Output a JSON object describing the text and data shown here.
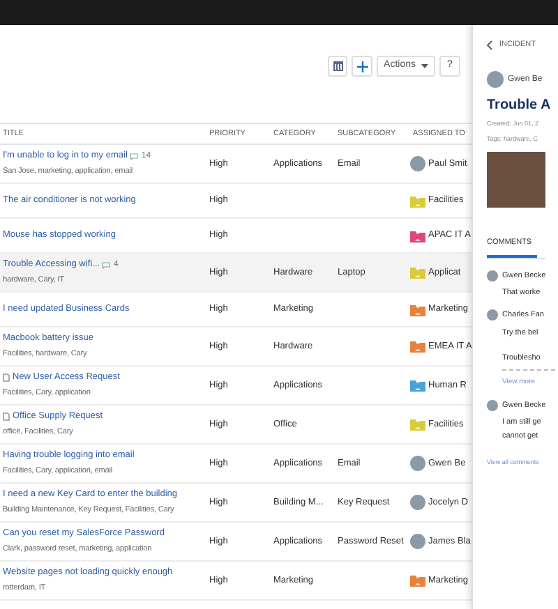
{
  "toolbar": {
    "actions_label": "Actions",
    "help_label": "?"
  },
  "table": {
    "columns": [
      "TITLE",
      "PRIORITY",
      "CATEGORY",
      "SUBCATEGORY",
      "ASSIGNED TO"
    ],
    "rows": [
      {
        "title": "I'm unable to log in to my email",
        "comment_count": "14",
        "tags": "San Jose, marketing, application, email",
        "attachment": false,
        "selected": false,
        "priority": "High",
        "category": "Applications",
        "subcategory": "Email",
        "assigned": {
          "name": "Paul Smit",
          "kind": "person"
        }
      },
      {
        "title": "The air conditioner is not working",
        "attachment": false,
        "selected": false,
        "priority": "High",
        "category": "",
        "subcategory": "",
        "assigned": {
          "name": "Facilities",
          "kind": "group",
          "color": "#d8cc3a"
        }
      },
      {
        "title": "Mouse has stopped working",
        "attachment": false,
        "selected": false,
        "priority": "High",
        "category": "",
        "subcategory": "",
        "assigned": {
          "name": "APAC IT A",
          "kind": "group",
          "color": "#e0457b"
        }
      },
      {
        "title": "Trouble Accessing wifi...",
        "comment_count": "4",
        "tags": "hardware, Cary, IT",
        "attachment": false,
        "selected": true,
        "priority": "High",
        "category": "Hardware",
        "subcategory": "Laptop",
        "assigned": {
          "name": "Applicat",
          "kind": "group",
          "color": "#d8cc3a"
        }
      },
      {
        "title": "I need updated Business Cards",
        "attachment": false,
        "selected": false,
        "priority": "High",
        "category": "Marketing",
        "subcategory": "",
        "assigned": {
          "name": "Marketing",
          "kind": "group",
          "color": "#e8813a"
        }
      },
      {
        "title": "Macbook battery issue",
        "tags": "Facilities, hardware, Cary",
        "attachment": false,
        "selected": false,
        "priority": "High",
        "category": "Hardware",
        "subcategory": "",
        "assigned": {
          "name": "EMEA IT A",
          "kind": "group",
          "color": "#e8813a"
        }
      },
      {
        "title": "New User Access Request",
        "tags": "Facilities, Cary, application",
        "attachment": true,
        "selected": false,
        "priority": "High",
        "category": "Applications",
        "subcategory": "",
        "assigned": {
          "name": "Human R",
          "kind": "group",
          "color": "#4aa3d8"
        }
      },
      {
        "title": "Office Supply Request",
        "tags": "office, Facilities, Cary",
        "attachment": true,
        "selected": false,
        "priority": "High",
        "category": "Office",
        "subcategory": "",
        "assigned": {
          "name": "Facilities",
          "kind": "group",
          "color": "#d8cc3a"
        }
      },
      {
        "title": "Having trouble logging into email",
        "tags": "Facilities, Cary, application, email",
        "attachment": false,
        "selected": false,
        "priority": "High",
        "category": "Applications",
        "subcategory": "Email",
        "assigned": {
          "name": "Gwen Be",
          "kind": "person"
        }
      },
      {
        "title": "I need a new Key Card to enter the building",
        "tags": "Building Maintenance, Key Request, Facilities, Cary",
        "attachment": false,
        "selected": false,
        "priority": "High",
        "category": "Building M...",
        "subcategory": "Key Request",
        "assigned": {
          "name": "Jocelyn D",
          "kind": "person"
        }
      },
      {
        "title": "Can you reset my SalesForce Password",
        "tags": "Clark, password reset, marketing, application",
        "attachment": false,
        "selected": false,
        "priority": "High",
        "category": "Applications",
        "subcategory": "Password Reset",
        "assigned": {
          "name": "James Bla",
          "kind": "person"
        }
      },
      {
        "title": "Website pages not loading quickly enough",
        "tags": "rotterdam, IT",
        "attachment": false,
        "selected": false,
        "priority": "High",
        "category": "Marketing",
        "subcategory": "",
        "assigned": {
          "name": "Marketing",
          "kind": "group",
          "color": "#e8813a"
        }
      }
    ]
  },
  "detail": {
    "breadcrumb": "INCIDENT",
    "author": "Gwen Be",
    "title": "Trouble A",
    "created": "Created: Jun 01, 2",
    "tags": "Tags: hardware, C",
    "tab": "COMMENTS",
    "comments": [
      {
        "author": "Gwen Becke",
        "lines": [
          "That worke"
        ]
      },
      {
        "author": "Charles Fan",
        "lines": [
          "Try the bel"
        ],
        "note": "Troublesho",
        "view_more": "View more"
      },
      {
        "author": "Gwen Becke",
        "lines": [
          "I am still ge",
          "cannot get"
        ]
      }
    ],
    "view_all": "View all comments"
  }
}
